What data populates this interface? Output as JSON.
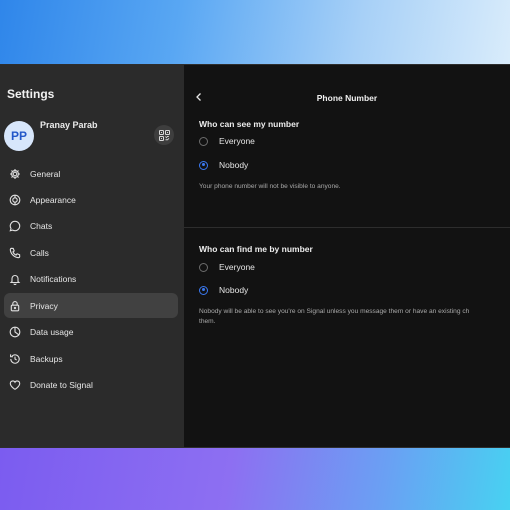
{
  "sidebar": {
    "title": "Settings",
    "profile": {
      "initials": "PP",
      "name": "Pranay Parab"
    },
    "items": [
      {
        "label": "General",
        "icon": "gear-icon"
      },
      {
        "label": "Appearance",
        "icon": "appearance-icon"
      },
      {
        "label": "Chats",
        "icon": "chat-bubble-icon"
      },
      {
        "label": "Calls",
        "icon": "phone-icon"
      },
      {
        "label": "Notifications",
        "icon": "bell-icon"
      },
      {
        "label": "Privacy",
        "icon": "lock-icon",
        "active": true
      },
      {
        "label": "Data usage",
        "icon": "pie-chart-icon"
      },
      {
        "label": "Backups",
        "icon": "backup-icon"
      },
      {
        "label": "Donate to Signal",
        "icon": "heart-icon"
      }
    ]
  },
  "main": {
    "title": "Phone Number",
    "see_section": {
      "title": "Who can see my number",
      "options": [
        "Everyone",
        "Nobody"
      ],
      "selected": "Nobody",
      "help": "Your phone number will not be visible to anyone."
    },
    "find_section": {
      "title": "Who can find me by number",
      "options": [
        "Everyone",
        "Nobody"
      ],
      "selected": "Nobody",
      "help_line1": "Nobody will be able to see you're on Signal unless you message them or have an existing ch",
      "help_line2": "them."
    }
  },
  "colors": {
    "accent": "#3a78f0",
    "sidebar_bg": "#2b2b2b",
    "main_bg": "#121212"
  }
}
